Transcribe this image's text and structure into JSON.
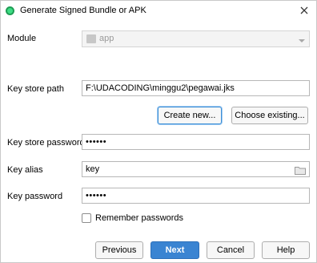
{
  "dialog": {
    "title": "Generate Signed Bundle or APK",
    "close_icon": "close-icon",
    "app_icon": "android-studio-icon"
  },
  "form": {
    "module_label": "Module",
    "module_value": "app",
    "keystore_path_label": "Key store path",
    "keystore_path_value": "F:\\UDACODING\\minggu2\\pegawai.jks",
    "create_new_label": "Create new...",
    "choose_existing_label": "Choose existing...",
    "keystore_password_label": "Key store password",
    "keystore_password_value": "••••••",
    "key_alias_label": "Key alias",
    "key_alias_value": "key",
    "key_password_label": "Key password",
    "key_password_value": "••••••",
    "remember_label": "Remember passwords",
    "remember_checked": false
  },
  "footer": {
    "previous_label": "Previous",
    "next_label": "Next",
    "cancel_label": "Cancel",
    "help_label": "Help"
  },
  "colors": {
    "primary_button": "#3a84d2",
    "focus_border": "#3c8fd6"
  }
}
